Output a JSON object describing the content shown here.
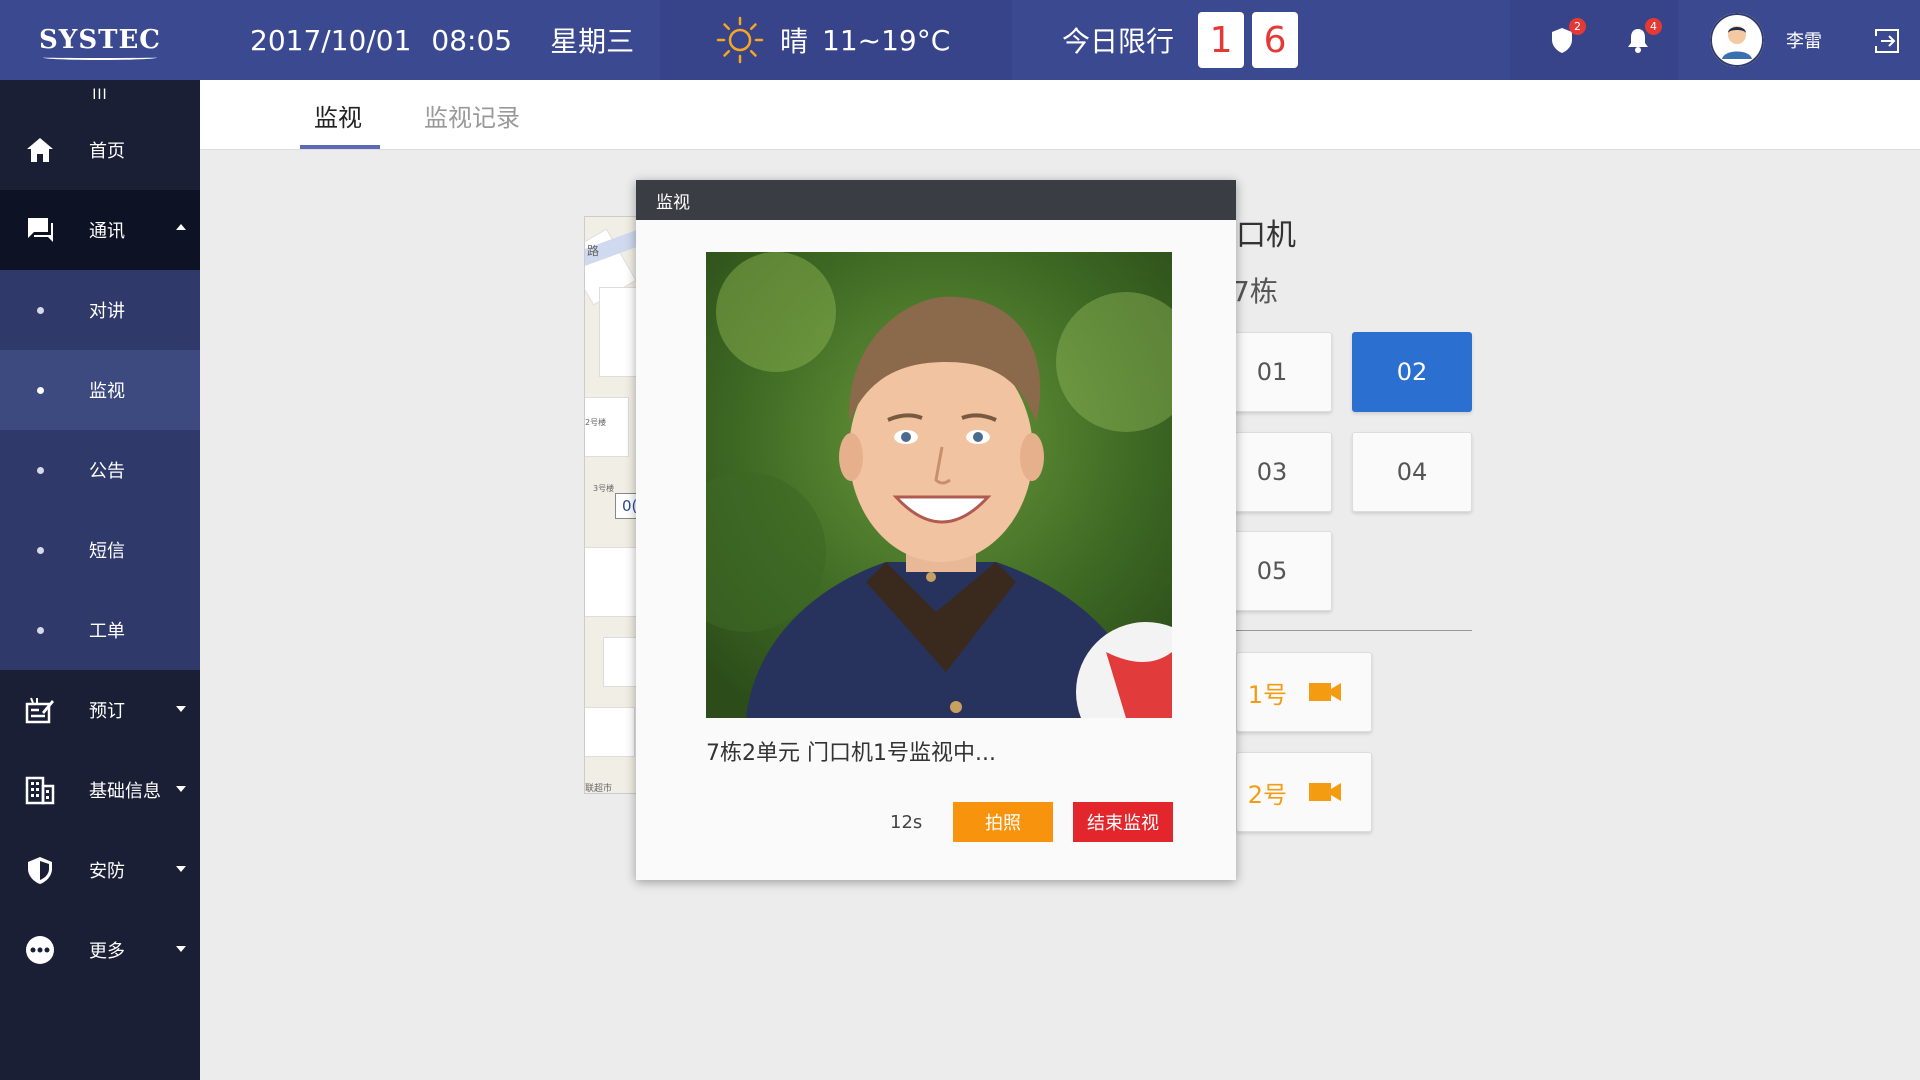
{
  "header": {
    "logo": "SYSTEC",
    "date": "2017/10/01",
    "time": "08:05",
    "weekday": "星期三",
    "weather_text": "晴",
    "temperature": "11~19°C",
    "limit_label": "今日限行",
    "limit_digits": [
      "1",
      "6"
    ],
    "alert_badge": "2",
    "notification_badge": "4",
    "username": "李雷"
  },
  "sidebar": {
    "collapse": "III",
    "items": [
      {
        "label": "首页",
        "icon": "home-icon"
      },
      {
        "label": "通讯",
        "icon": "chat-icon",
        "open": true
      },
      {
        "label": "预订",
        "icon": "booking-icon"
      },
      {
        "label": "基础信息",
        "icon": "building-icon"
      },
      {
        "label": "安防",
        "icon": "shield-icon"
      },
      {
        "label": "更多",
        "icon": "more-icon"
      }
    ],
    "sub_items": [
      {
        "label": "对讲"
      },
      {
        "label": "监视",
        "active": true
      },
      {
        "label": "公告"
      },
      {
        "label": "短信"
      },
      {
        "label": "工单"
      }
    ]
  },
  "tabs": [
    {
      "label": "监视",
      "active": true
    },
    {
      "label": "监视记录"
    }
  ],
  "panel": {
    "building_title": "口机",
    "building_subtitle": "7栋",
    "units": [
      "01",
      "02",
      "03",
      "04",
      "05"
    ],
    "active_unit": "02",
    "cameras": [
      "1号",
      "2号"
    ]
  },
  "map": {
    "road_label": "路",
    "building_label_2": "2号楼",
    "building_label_3": "3号楼",
    "marker": "0(",
    "footer": "联超市"
  },
  "modal": {
    "title": "监视",
    "status": "7栋2单元  门口机1号监视中...",
    "timer": "12s",
    "photo_button": "拍照",
    "stop_button": "结束监视"
  },
  "colors": {
    "header": "#3b4990",
    "sidebar": "#1a1f36",
    "sub_active": "#3d4a80",
    "accent_blue": "#2b6fd1",
    "orange": "#f7930d",
    "red": "#e3262b"
  }
}
